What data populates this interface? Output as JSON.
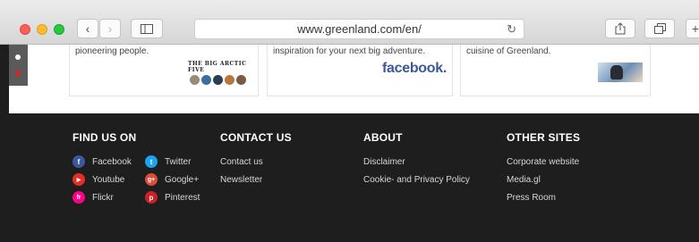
{
  "browser": {
    "url": "www.greenland.com/en/"
  },
  "cards": [
    {
      "text": "pioneering people.",
      "logo_text": "THE BIG ARCTIC FIVE"
    },
    {
      "text": "inspiration for your next big adventure.",
      "logo_text": "facebook."
    },
    {
      "text": "cuisine of Greenland."
    }
  ],
  "footer": {
    "find_us": {
      "title": "FIND US ON",
      "links": [
        {
          "label": "Facebook",
          "icon": "facebook-icon",
          "color": "#3b5998",
          "glyph": "f"
        },
        {
          "label": "Twitter",
          "icon": "twitter-icon",
          "color": "#1da1f2",
          "glyph": "t"
        },
        {
          "label": "Youtube",
          "icon": "youtube-icon",
          "color": "#e52d27",
          "glyph": "▶"
        },
        {
          "label": "Google+",
          "icon": "googleplus-icon",
          "color": "#dd4b39",
          "glyph": "g+"
        },
        {
          "label": "Flickr",
          "icon": "flickr-icon",
          "color": "#ff0084",
          "glyph": "fr"
        },
        {
          "label": "Pinterest",
          "icon": "pinterest-icon",
          "color": "#cb2027",
          "glyph": "p"
        }
      ]
    },
    "contact": {
      "title": "CONTACT US",
      "links": [
        "Contact us",
        "Newsletter"
      ]
    },
    "about": {
      "title": "ABOUT",
      "links": [
        "Disclaimer",
        "Cookie- and Privacy Policy"
      ]
    },
    "other": {
      "title": "OTHER SITES",
      "links": [
        "Corporate website",
        "Media.gl",
        "Press Room"
      ]
    }
  },
  "colors": {
    "footer_bg": "#1e1e1e",
    "facebook_blue": "#3b5998",
    "sidebar_dot_active": "#ffffff",
    "sidebar_dot_inactive": "#e02020"
  }
}
